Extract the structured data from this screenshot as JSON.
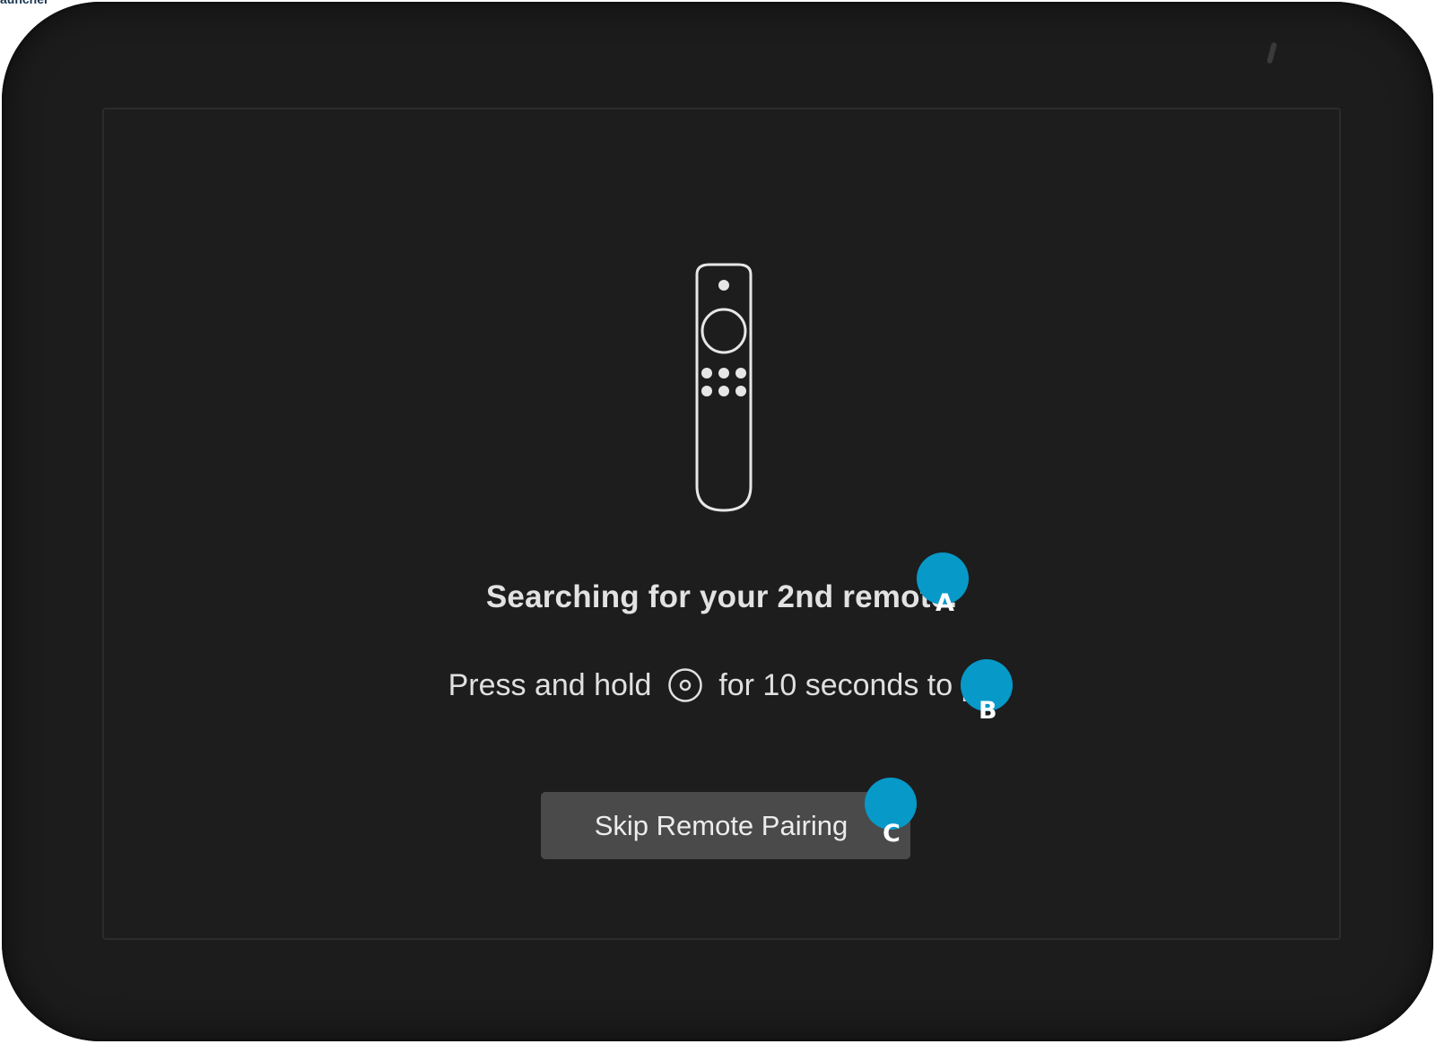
{
  "header": {
    "corner_label": "auncher"
  },
  "device": {
    "camera_icon": "camera-dot-icon"
  },
  "screen": {
    "illustration_icon": "fire-tv-remote-icon",
    "title": "Searching for your 2nd remote.",
    "instruction": {
      "before": "Press and hold",
      "icon": "home-button-icon",
      "after": "for 10 seconds to pa"
    },
    "skip_button_label": "Skip Remote Pairing"
  },
  "markers": [
    {
      "letter": "A"
    },
    {
      "letter": "B"
    },
    {
      "letter": "C"
    }
  ],
  "colors": {
    "device_frame": "#1c1c1c",
    "screen_background": "#1d1d1e",
    "button_background": "#4a4a4b",
    "marker": "#0799c8",
    "text": "#e2e2e2"
  }
}
